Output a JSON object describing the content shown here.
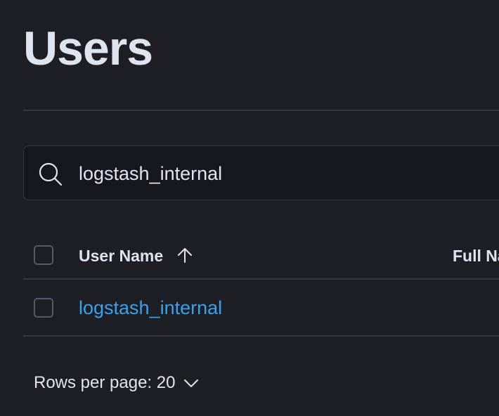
{
  "page": {
    "title": "Users"
  },
  "search": {
    "value": "logstash_internal",
    "icon": "search-icon"
  },
  "table": {
    "columns": [
      {
        "label": "User Name",
        "sort": "ascending",
        "sort_icon": "arrow-up-icon"
      },
      {
        "label": "Full Na"
      }
    ],
    "rows": [
      {
        "username": "logstash_internal"
      }
    ]
  },
  "pagination": {
    "rows_per_page_label": "Rows per page: 20",
    "icon": "chevron-down-icon"
  },
  "colors": {
    "background": "#1d1e24",
    "text": "#dfe5ef",
    "link": "#36a2ef",
    "border": "#343741",
    "input_bg": "#16171c"
  }
}
